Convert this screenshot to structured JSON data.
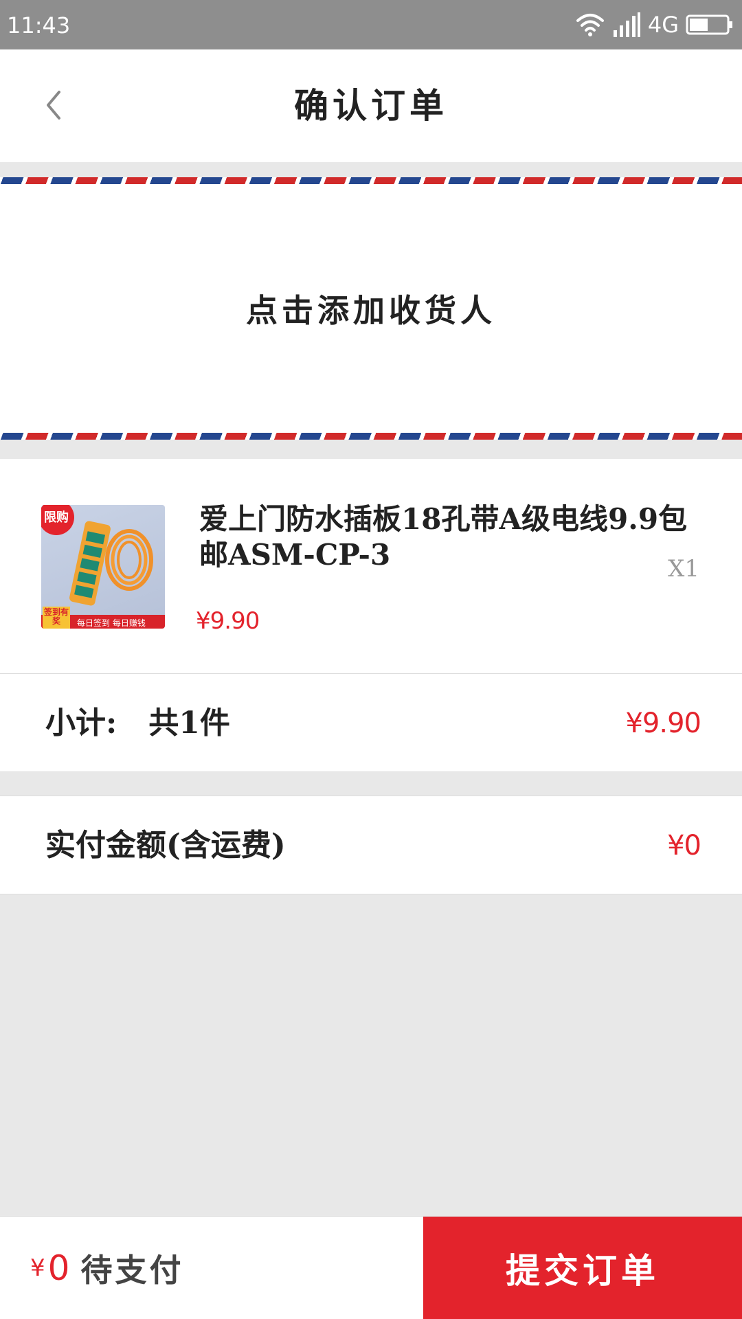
{
  "status_bar": {
    "time": "11:43",
    "network": "4G",
    "icons": [
      "wifi-icon",
      "signal-icon",
      "battery-icon"
    ]
  },
  "header": {
    "back_icon": "chevron-left-icon",
    "title": "确认订单"
  },
  "address": {
    "add_label": "点击添加收货人"
  },
  "product": {
    "name": "爱上门防水插板18孔带A级电线9.9包邮ASM-CP-3",
    "quantity": "X1",
    "price": "¥9.90",
    "badge": "限购",
    "promo_tag": "签到有奖",
    "promo_text": "每日签到 每日赚钱"
  },
  "subtotal": {
    "label": "小计:",
    "count": "共1件",
    "amount": "¥9.90"
  },
  "actual_payment": {
    "label": "实付金额(含运费)",
    "amount": "¥0"
  },
  "bottom_bar": {
    "currency": "¥",
    "amount": "0",
    "status_label": "待支付",
    "submit_label": "提交订单"
  },
  "colors": {
    "accent": "#e3232c",
    "stripe_red": "#d12a2a",
    "stripe_blue": "#24478f",
    "background": "#e8e8e8",
    "status_bar": "#8e8e8e"
  }
}
